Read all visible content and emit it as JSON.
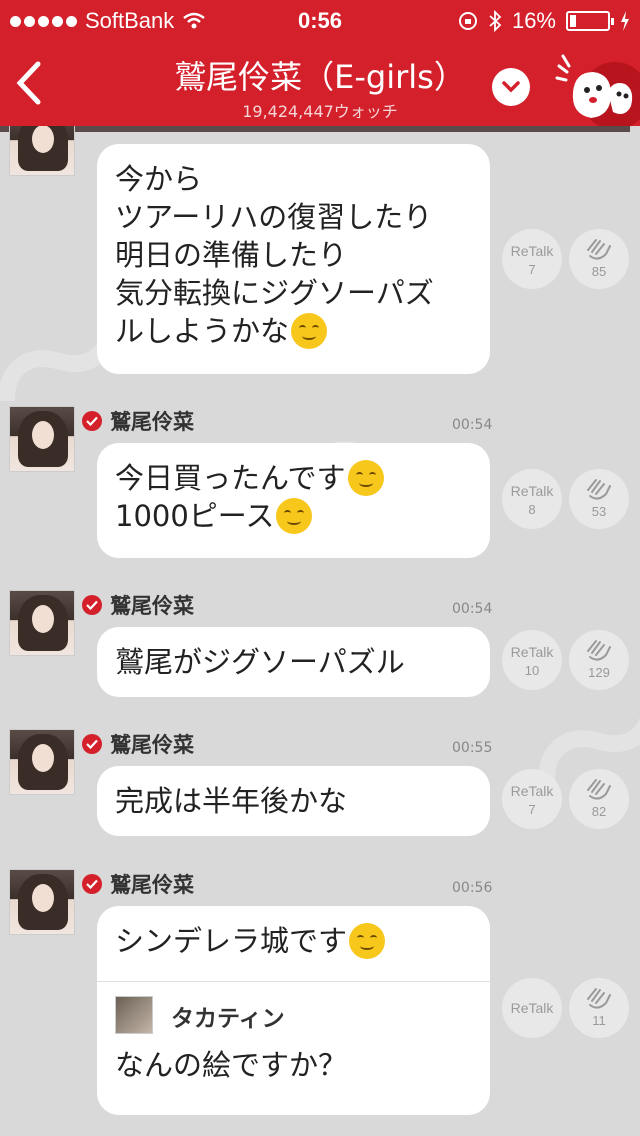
{
  "status_bar": {
    "carrier": "SoftBank",
    "time": "0:56",
    "battery": "16%"
  },
  "nav": {
    "title": "鷲尾伶菜（E-girls）",
    "watch_count": "19,424,447ウォッチ"
  },
  "messages": [
    {
      "user": "",
      "time": "",
      "lines": [
        "今から",
        "ツアーリハの復習したり",
        "明日の準備したり",
        "気分転換にジグソーパズ",
        "ルしようかな"
      ],
      "emoji_end": true,
      "retalk_label": "ReTalk",
      "retalk_count": "7",
      "clap_count": "85"
    },
    {
      "user": "鷲尾伶菜",
      "time": "00:54",
      "lines": [
        "今日買ったんです",
        "1000ピース"
      ],
      "retalk_label": "ReTalk",
      "retalk_count": "8",
      "clap_count": "53"
    },
    {
      "user": "鷲尾伶菜",
      "time": "00:54",
      "lines": [
        "鷲尾がジグソーパズル"
      ],
      "retalk_label": "ReTalk",
      "retalk_count": "10",
      "clap_count": "129"
    },
    {
      "user": "鷲尾伶菜",
      "time": "00:55",
      "lines": [
        "完成は半年後かな"
      ],
      "retalk_label": "ReTalk",
      "retalk_count": "7",
      "clap_count": "82"
    },
    {
      "user": "鷲尾伶菜",
      "time": "00:56",
      "lines": [
        "シンデレラ城です"
      ],
      "quote_user": "タカティン",
      "quote_text": "なんの絵ですか？",
      "retalk_label": "ReTalk",
      "clap_count": "11"
    }
  ],
  "colors": {
    "brand_red": "#d4202b",
    "background": "#d9d9d9",
    "bubble": "#ffffff"
  }
}
